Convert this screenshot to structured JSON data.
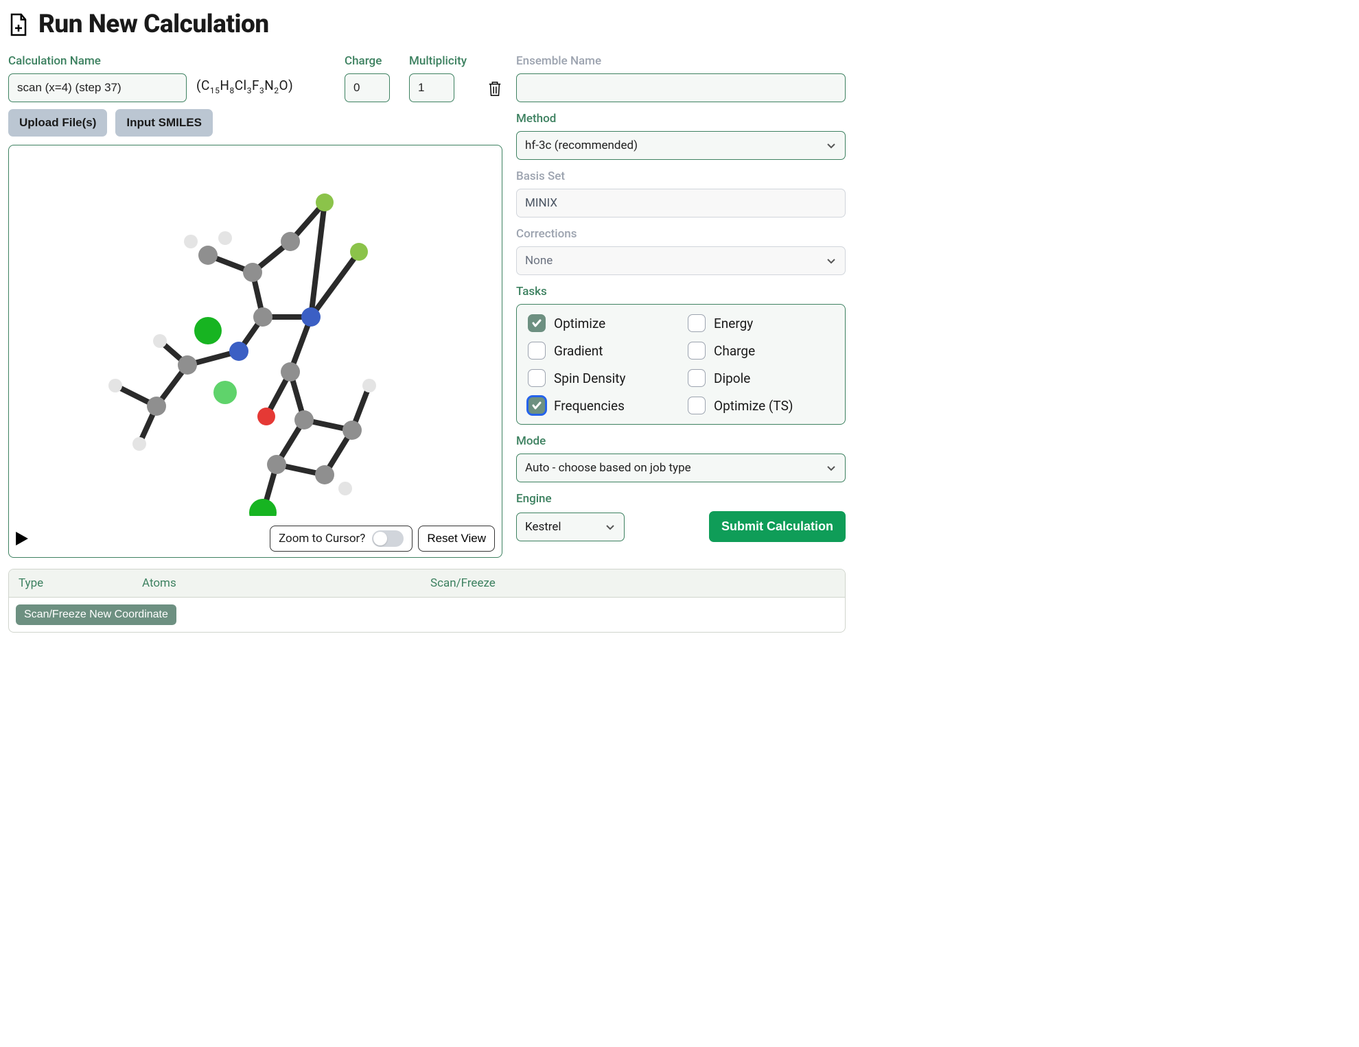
{
  "header": {
    "title": "Run New Calculation"
  },
  "calc_name": {
    "label": "Calculation Name",
    "value": "scan (x=4) (step 37)"
  },
  "formula_html": "(C<sub>15</sub>H<sub>8</sub>Cl<sub>3</sub>F<sub>3</sub>N<sub>2</sub>O)",
  "charge": {
    "label": "Charge",
    "value": "0"
  },
  "multiplicity": {
    "label": "Multiplicity",
    "value": "1"
  },
  "buttons": {
    "upload": "Upload File(s)",
    "smiles": "Input SMILES",
    "zoom_to_cursor": "Zoom to Cursor?",
    "reset_view": "Reset View",
    "scan_new": "Scan/Freeze New Coordinate",
    "submit": "Submit Calculation"
  },
  "ensemble": {
    "label": "Ensemble Name",
    "value": ""
  },
  "method": {
    "label": "Method",
    "value": "hf-3c (recommended)"
  },
  "basis": {
    "label": "Basis Set",
    "value": "MINIX"
  },
  "corrections": {
    "label": "Corrections",
    "value": "None"
  },
  "tasks": {
    "label": "Tasks",
    "items": [
      {
        "label": "Optimize",
        "checked": true,
        "focused": false
      },
      {
        "label": "Energy",
        "checked": false,
        "focused": false
      },
      {
        "label": "Gradient",
        "checked": false,
        "focused": false
      },
      {
        "label": "Charge",
        "checked": false,
        "focused": false
      },
      {
        "label": "Spin Density",
        "checked": false,
        "focused": false
      },
      {
        "label": "Dipole",
        "checked": false,
        "focused": false
      },
      {
        "label": "Frequencies",
        "checked": true,
        "focused": true
      },
      {
        "label": "Optimize (TS)",
        "checked": false,
        "focused": false
      }
    ]
  },
  "mode": {
    "label": "Mode",
    "value": "Auto - choose based on job type"
  },
  "engine": {
    "label": "Engine",
    "value": "Kestrel"
  },
  "scan_table": {
    "cols": {
      "type": "Type",
      "atoms": "Atoms",
      "scan": "Scan/Freeze"
    }
  }
}
